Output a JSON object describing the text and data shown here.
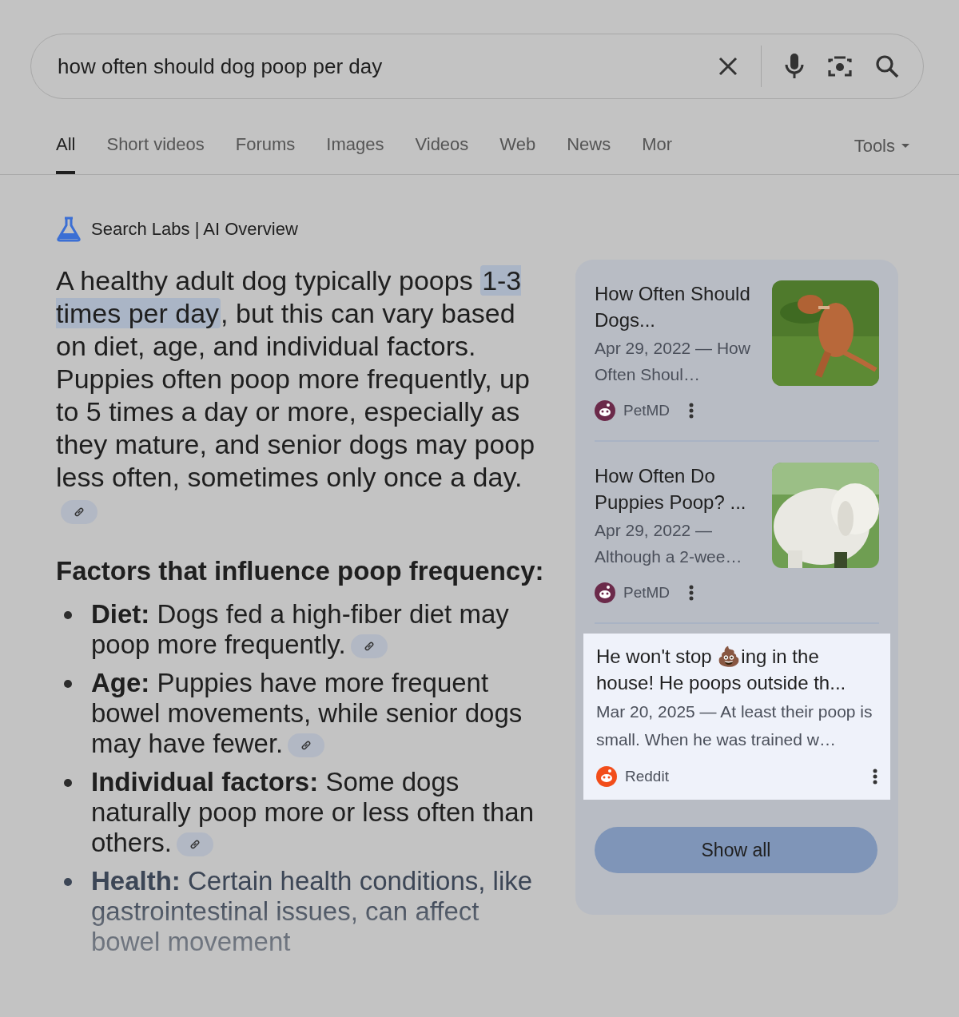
{
  "search": {
    "value": "how often should dog poop per day"
  },
  "tabs": [
    {
      "label": "All",
      "selected": true
    },
    {
      "label": "Short videos",
      "selected": false
    },
    {
      "label": "Forums",
      "selected": false
    },
    {
      "label": "Images",
      "selected": false
    },
    {
      "label": "Videos",
      "selected": false
    },
    {
      "label": "Web",
      "selected": false
    },
    {
      "label": "News",
      "selected": false
    },
    {
      "label": "Mor",
      "selected": false
    }
  ],
  "tools": "Tools",
  "overview": {
    "label": "Search Labs | AI Overview",
    "summary": "A healthy adult dog typically poops ",
    "summary_highlight": "1-3 times per day",
    "summary_rest": ", but this can vary based on diet, age, and individual factors. Puppies often poop more frequently, up to 5 times a day or more, especially as they mature, and senior dogs may poop less often, sometimes only once a day.",
    "heading": "Factors that influence poop frequency:",
    "factors": [
      {
        "text": "**Diet:** Dogs fed a high-fiber diet may poop more frequently.",
        "faded": false
      },
      {
        "text": "**Age:** Puppies have more frequent bowel movements, while senior dogs may have fewer.",
        "faded": false
      },
      {
        "text": "**Individual factors:** Some dogs naturally poop more or less often than others.",
        "faded": false
      },
      {
        "text": "**Health:** Certain health conditions, like gastrointestinal issues, can affect bowel movement",
        "faded": true
      }
    ]
  },
  "sources": [
    {
      "title": "How Often Should Dogs...",
      "snippet": "Apr 29, 2022 — How Often Shoul…",
      "site": "PetMD",
      "color": "#6b2a4a",
      "highlighted": false
    },
    {
      "title": "How Often Do Puppies Poop? ...",
      "snippet": "Apr 29, 2022 — Although a 2-wee…",
      "site": "PetMD",
      "color": "#6b2a4a",
      "highlighted": false
    },
    {
      "title": "He won't stop 💩ing in the house! He poops outside th...",
      "snippet": "Mar 20, 2025 — At least their poop is small. When he was trained w…",
      "site": "Reddit",
      "color": "#f24d1a",
      "highlighted": true
    }
  ],
  "show_all": "Show all"
}
